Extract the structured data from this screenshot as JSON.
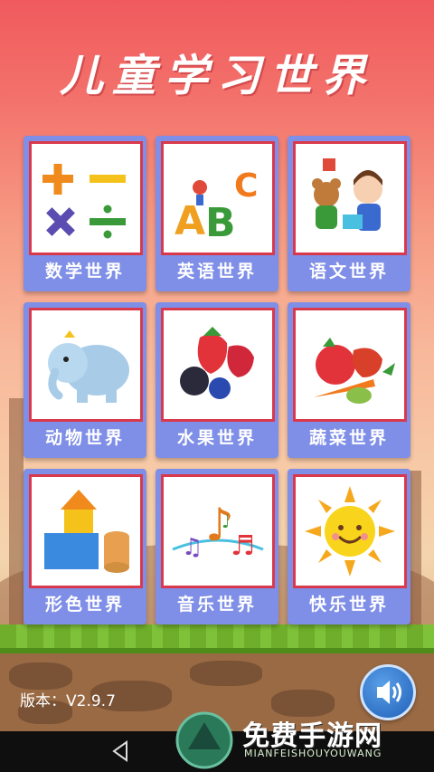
{
  "app": {
    "title": "儿童学习世界"
  },
  "cards": [
    {
      "label": "数学世界",
      "icon": "math-symbols-icon"
    },
    {
      "label": "英语世界",
      "icon": "abc-letters-icon"
    },
    {
      "label": "语文世界",
      "icon": "kids-reading-icon"
    },
    {
      "label": "动物世界",
      "icon": "elephant-icon"
    },
    {
      "label": "水果世界",
      "icon": "fruits-icon"
    },
    {
      "label": "蔬菜世界",
      "icon": "vegetables-icon"
    },
    {
      "label": "形色世界",
      "icon": "shapes-icon"
    },
    {
      "label": "音乐世界",
      "icon": "music-notes-icon"
    },
    {
      "label": "快乐世界",
      "icon": "sun-icon"
    }
  ],
  "version": {
    "text": "版本：V2.9.7"
  },
  "watermark": {
    "title": "免费手游网",
    "subtitle": "MIANFEISHOUYOUWANG"
  },
  "colors": {
    "card": "#7f8ee6",
    "frame": "#d9394a",
    "title_shadow": "#d34c4e"
  }
}
